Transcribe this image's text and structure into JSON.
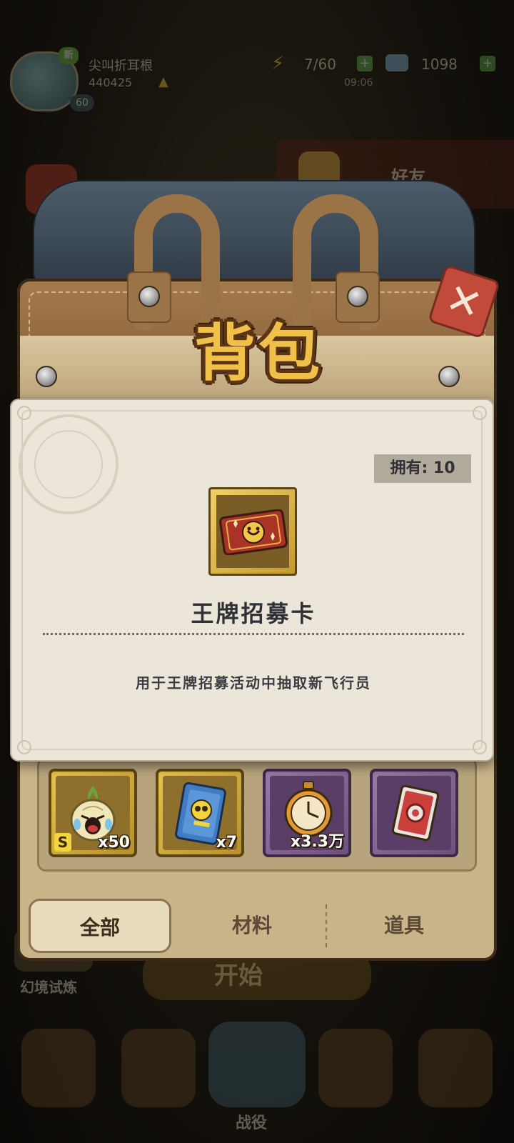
{
  "header": {
    "nickname": "尖叫折耳根",
    "new_badge": "新",
    "power": "440425",
    "level": "60",
    "energy": "7/60",
    "gems": "1098",
    "clock": "09:06"
  },
  "side": {
    "friends_label": "好友",
    "trial_label": "幻境试炼",
    "start_label": "开始"
  },
  "bottom_nav": {
    "center_label": "战役"
  },
  "backpack": {
    "title": "背包",
    "close_icon": "close-x-icon",
    "slots": [
      {
        "name": "crying-onion",
        "frame": "gold",
        "grade": "S",
        "qty": "x50"
      },
      {
        "name": "skill-book",
        "frame": "gold",
        "grade": "",
        "qty": "x7"
      },
      {
        "name": "stopwatch",
        "frame": "purple",
        "grade": "",
        "qty": "x3.3万"
      },
      {
        "name": "red-gear-card",
        "frame": "purple",
        "grade": "",
        "qty": ""
      }
    ],
    "tabs": [
      "全部",
      "材料",
      "道具"
    ],
    "active_tab": "全部"
  },
  "detail": {
    "owned": "拥有: 10",
    "item_name": "王牌招募卡",
    "item_desc": "用于王牌招募活动中抽取新飞行员"
  },
  "colors": {
    "gold_frame": "#e5c34d",
    "purple_frame": "#9a7aa8",
    "popup_bg": "#ece6da",
    "title_gold": "#f0c04a"
  }
}
